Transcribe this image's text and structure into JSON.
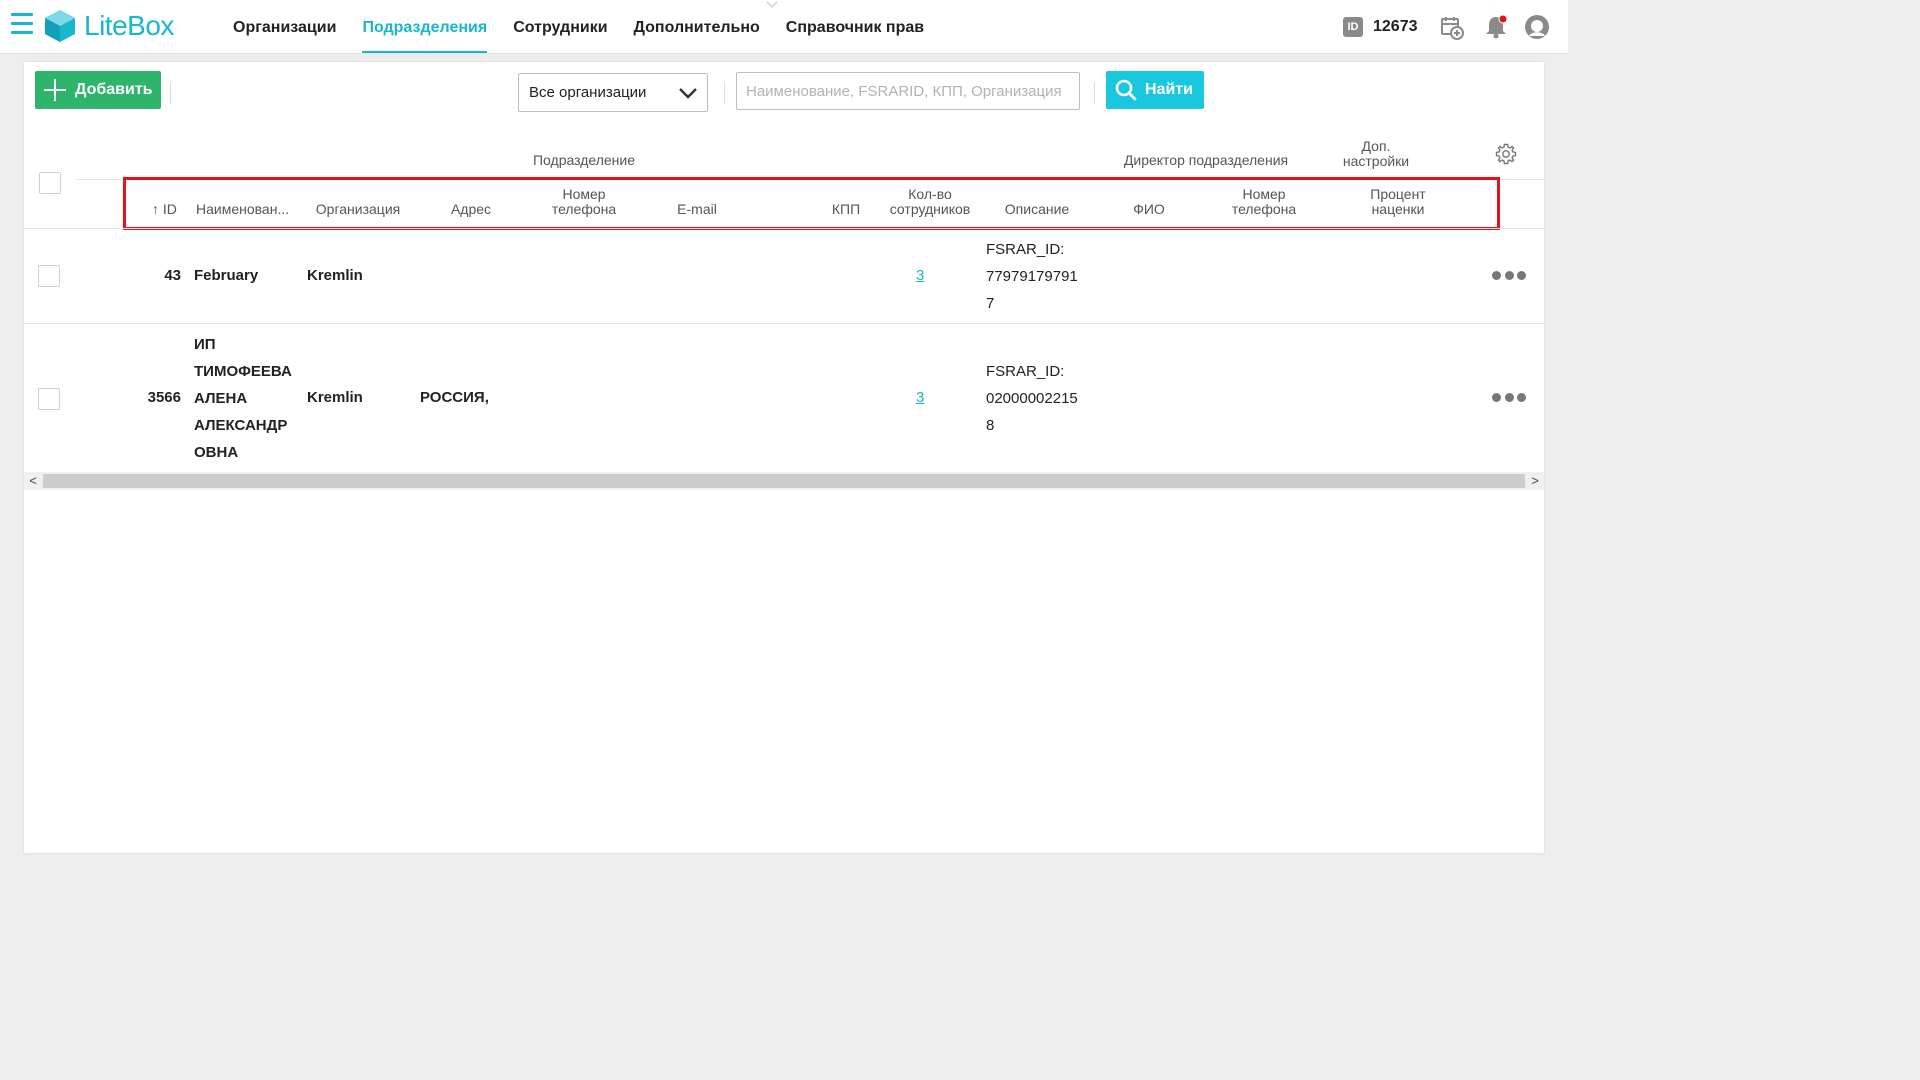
{
  "app": {
    "logo_text": "LiteBox"
  },
  "nav": [
    {
      "label": "Организации",
      "active": false
    },
    {
      "label": "Подразделения",
      "active": true
    },
    {
      "label": "Сотрудники",
      "active": false
    },
    {
      "label": "Дополнительно",
      "active": false
    },
    {
      "label": "Справочник прав",
      "active": false
    }
  ],
  "header_tools": {
    "id_badge": "ID",
    "id_value": "12673"
  },
  "toolbar": {
    "add_label": "Добавить",
    "org_select_value": "Все организации",
    "search_placeholder": "Наименование, FSRARID, КПП, Организация",
    "find_label": "Найти"
  },
  "table": {
    "group_headers": {
      "division": "Подразделение",
      "director": "Директор подразделения",
      "extra_line1": "Доп.",
      "extra_line2": "настройки"
    },
    "columns": {
      "id": "ID",
      "name": "Наименован...",
      "org": "Организация",
      "address": "Адрес",
      "phone_line1": "Номер",
      "phone_line2": "телефона",
      "email": "E-mail",
      "kpp": "КПП",
      "emp_line1": "Кол-во",
      "emp_line2": "сотрудников",
      "desc": "Описание",
      "fio": "ФИО",
      "dphone_line1": "Номер",
      "dphone_line2": "телефона",
      "markup_line1": "Процент",
      "markup_line2": "наценки"
    },
    "rows": [
      {
        "id": "43",
        "name_lines": [
          "February"
        ],
        "org": "Kremlin",
        "address": "",
        "employees": "3",
        "desc_lines": [
          "FSRAR_ID:",
          "77979179791",
          "7"
        ]
      },
      {
        "id": "3566",
        "name_lines": [
          "ИП",
          "ТИМОФЕЕВА",
          "АЛЕНА",
          "АЛЕКСАНДР",
          "ОВНА"
        ],
        "org": "Kremlin",
        "address": "РОССИЯ,",
        "employees": "3",
        "desc_lines": [
          "FSRAR_ID:",
          "02000002215",
          "8"
        ]
      }
    ]
  },
  "colors": {
    "accent": "#19b6cf",
    "add_button": "#2fb56b",
    "find_button": "#19c8df",
    "highlight": "#e4121b"
  }
}
